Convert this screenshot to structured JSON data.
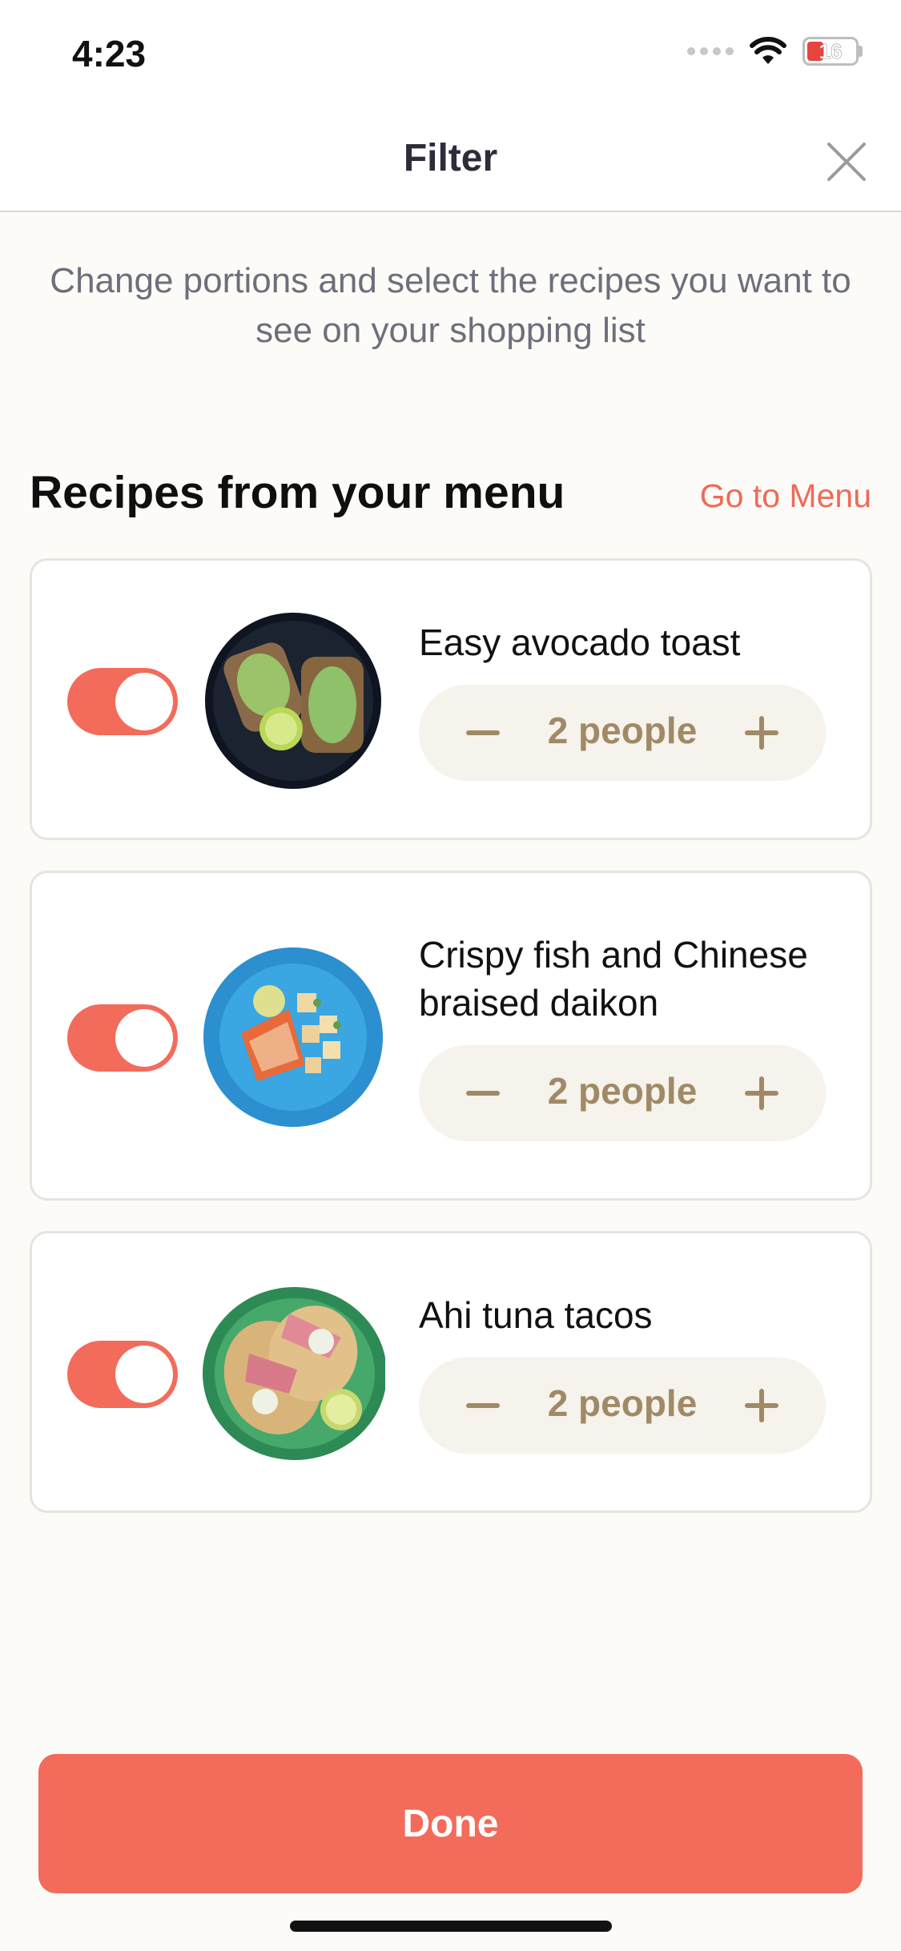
{
  "status_bar": {
    "time": "4:23",
    "battery": "16"
  },
  "header": {
    "title": "Filter",
    "close_icon": "close-icon"
  },
  "intro_text": "Change portions and select the recipes you want to see on your shopping list",
  "section": {
    "title": "Recipes from your menu",
    "link": "Go to Menu"
  },
  "recipes": [
    {
      "name": "Easy avocado toast",
      "portion": "2 people",
      "enabled": true
    },
    {
      "name": "Crispy fish and Chinese braised daikon",
      "portion": "2 people",
      "enabled": true
    },
    {
      "name": "Ahi tuna tacos",
      "portion": "2 people",
      "enabled": true
    }
  ],
  "done_button": "Done",
  "colors": {
    "accent": "#f26b5b",
    "link": "#ef6a59",
    "stepper_text": "#a08a66",
    "background": "#fdfbf7"
  }
}
